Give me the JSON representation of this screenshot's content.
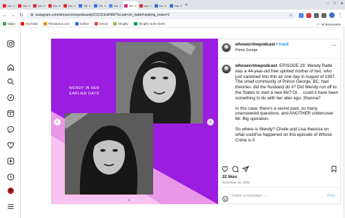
{
  "browser": {
    "tabs": [
      {
        "label": "Dou",
        "color": "#e03030"
      },
      {
        "label": "Wo",
        "color": "#e03030"
      },
      {
        "label": "Wo",
        "color": "#e03030"
      },
      {
        "label": "Wo",
        "color": "#e03030"
      },
      {
        "label": "Wo",
        "color": "#e03030"
      },
      {
        "label": "TBV",
        "color": "#3b6fd8"
      },
      {
        "label": "FBV",
        "color": "#3b6fd8"
      },
      {
        "label": "Wer",
        "color": "#4a8cf0"
      },
      {
        "label": "Wh",
        "color": "#d62976",
        "active": true
      },
      {
        "label": "wen",
        "color": "#e03030"
      },
      {
        "label": "Da",
        "color": "#3b6fd8"
      },
      {
        "label": "Rati",
        "color": "#3b6fd8"
      }
    ],
    "new_tab_label": "+",
    "url": "instagram.com/whosecrimepodcast/p/CI1OCtUtHIM/?locale=zh_tw&hl=ar&img_index=2",
    "bookmarks": [
      {
        "label": "Maps",
        "color": "#34a853"
      },
      {
        "label": "YouTube",
        "color": "#ff0000"
      },
      {
        "label": "Thesaurus.com",
        "color": "#f28b00"
      },
      {
        "label": "Gdrive",
        "color": "#1a73e8"
      },
      {
        "label": "Gmail",
        "color": "#ea4335"
      },
      {
        "label": "Shopify",
        "color": "#95bf47"
      },
      {
        "label": "Shopify work sheet",
        "color": "#0f9d58"
      }
    ],
    "all_bookmarks_label": "All Bookmarks"
  },
  "rail": {
    "icons": [
      "instagram-logo-icon",
      "home-icon",
      "search-icon",
      "explore-icon",
      "reels-icon",
      "messenger-icon",
      "notifications-icon",
      "create-icon",
      "profile-icon",
      "more-menu-icon"
    ]
  },
  "post": {
    "media": {
      "caption": "WENDY IN HER EARLIER DAYS",
      "slide_count": 6,
      "active_slide": 2,
      "background_color": "#9b1de0"
    },
    "header": {
      "username": "whosecrimepodcast",
      "separator": "•",
      "follow_label": "track",
      "location": "Prince George"
    },
    "caption": {
      "username": "whosecrimepodcast",
      "paragraphs": [
        "⁩ EPISODE 29: Wendy Ratté was a 44-year-old free spirited mother of two, who just vanished into thin air one day in August of 1997. The small community of Prince George, BC, had theories: did the husband do it? Did Wendy run off to the States to start a new life? Or… could it have been something to do with her alter ego: Shanna?",
        "In this case, there's a secret past, so many unanswered questions, and ANOTHER undercover Mr. Big operation.",
        "So where is Wendy? Chelle and Lisa theorise on what could've happened on this episode of Whose Crime is it"
      ]
    },
    "likes": "32 likes",
    "date": "December 16, 2020",
    "comment_placeholder": "Leave a message……",
    "post_button": "Post"
  }
}
